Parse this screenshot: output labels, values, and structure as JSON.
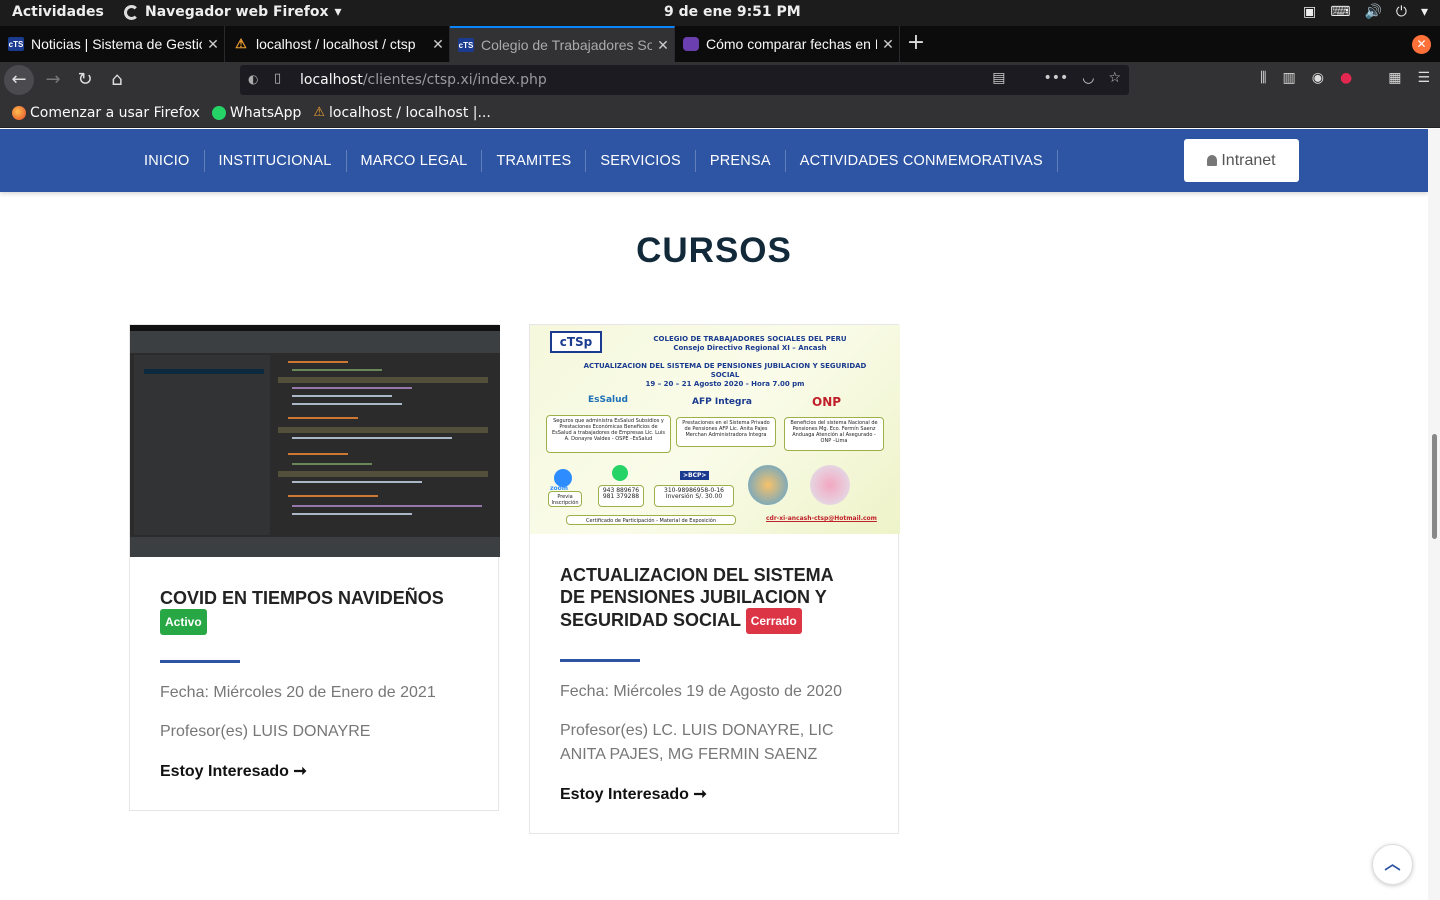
{
  "system": {
    "activities": "Actividades",
    "app_name": "Navegador web Firefox",
    "clock": "9 de ene   9:51 PM"
  },
  "tabs": [
    {
      "title": "Noticias | Sistema de Gestión",
      "favicon": "ctsp-icon"
    },
    {
      "title": "localhost / localhost / ctsp",
      "favicon": "phpmyadmin-icon"
    },
    {
      "title": "Colegio de Trabajadores Sociales",
      "favicon": "ctsp-icon"
    },
    {
      "title": "Cómo comparar fechas en PHP",
      "favicon": "shield-icon"
    }
  ],
  "urlbar": {
    "host": "localhost",
    "path": "/clientes/ctsp.xi/index.php"
  },
  "bookmarks": [
    {
      "label": "Comenzar a usar Firefox",
      "icon": "firefox-icon"
    },
    {
      "label": "WhatsApp",
      "icon": "whatsapp-icon"
    },
    {
      "label": "localhost / localhost |...",
      "icon": "phpmyadmin-icon"
    }
  ],
  "site_menu": [
    "INICIO",
    "INSTITUCIONAL",
    "MARCO LEGAL",
    "TRAMITES",
    "SERVICIOS",
    "PRENSA",
    "ACTIVIDADES CONMEMORATIVAS"
  ],
  "intranet_label": "Intranet",
  "section_title": "CURSOS",
  "courses": [
    {
      "title": "COVID EN TIEMPOS NAVIDEÑOS",
      "status": "Activo",
      "date": "Fecha: Miércoles 20 de Enero de 2021",
      "teachers": "Profesor(es) LUIS DONAYRE",
      "cta": "Estoy Interesado ➞"
    },
    {
      "title": "ACTUALIZACION DEL SISTEMA DE PENSIONES JUBILACION Y SEGURIDAD SOCIAL",
      "status": "Cerrado",
      "date": "Fecha: Miércoles 19 de Agosto de 2020",
      "teachers": "Profesor(es) LC. LUIS DONAYRE, LIC ANITA PAJES, MG FERMIN SAENZ",
      "cta": "Estoy Interesado ➞"
    }
  ],
  "poster": {
    "logo": "cTSp",
    "header": "COLEGIO DE TRABAJADORES SOCIALES    DEL PERU\nConsejo Directivo Regional XI – Ancash",
    "subtitle": "ACTUALIZACION DEL SISTEMA DE PENSIONES JUBILACION Y SEGURIDAD SOCIAL\n19 – 20 – 21 Agosto  2020 -  Hora 7.00 pm",
    "essalud": "EsSalud",
    "afp": "AFP Integra",
    "onp": "ONP",
    "box1": "Seguros que administra EsSalud Subsidios y Prestaciones Económicas Beneficios de EsSalud a trabajadores de Empresas Lic. Luis A. Donayre Valdes - OSPE –EsSalud",
    "box2": "Prestaciones en el Sistema Privado de Pensiones AFP Lic. Anita Pajes Merchan Administradora Integra",
    "box3": "Beneficios del sistema Nacional de Pensiones Mg. Eco. Fermín Saenz Anduaga Atención al Asegurado - ONP –Lima",
    "zoom": "zoom",
    "prev": "Previa Inscripción",
    "phones": "943 889676\n981 379288",
    "bcp": ">BCP>",
    "account": "310-98986958-0-16\nInversión S/. 30.00",
    "cert": "Certificado de Participación - Material de Exposición",
    "email": "cdr-xi-ancash-ctsp@Hotmail.com"
  },
  "colors": {
    "nav_blue": "#2e55a3",
    "title_dark": "#12293a",
    "badge_green": "#28a745",
    "badge_red": "#dc3545"
  }
}
